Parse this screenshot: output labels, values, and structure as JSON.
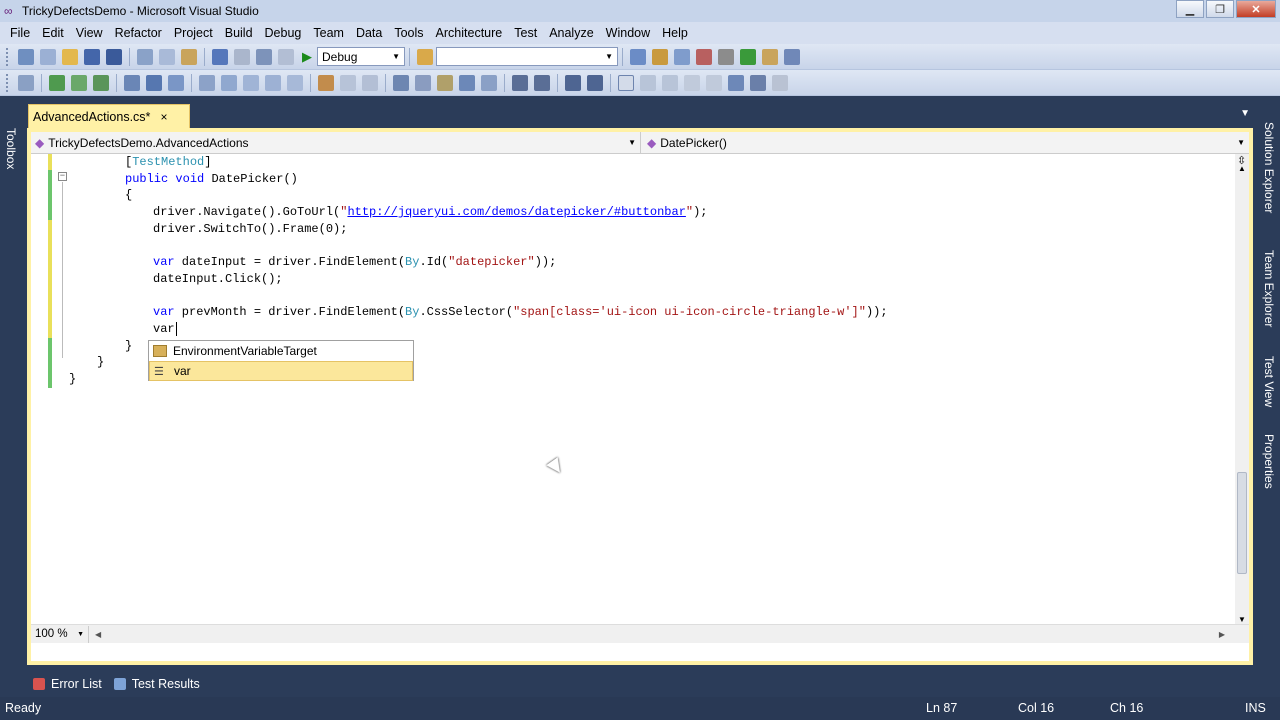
{
  "window": {
    "title": "TrickyDefectsDemo - Microsoft Visual Studio"
  },
  "menu": [
    "File",
    "Edit",
    "View",
    "Refactor",
    "Project",
    "Build",
    "Debug",
    "Team",
    "Data",
    "Tools",
    "Architecture",
    "Test",
    "Analyze",
    "Window",
    "Help"
  ],
  "toolbar": {
    "config_value": "Debug",
    "platform_value": ""
  },
  "sidebars": {
    "left": "Toolbox",
    "right": [
      "Solution Explorer",
      "Team Explorer",
      "Test View",
      "Properties"
    ]
  },
  "doc_tab": {
    "label": "AdvancedActions.cs*",
    "close": "×"
  },
  "nav": {
    "type_selector": "TrickyDefectsDemo.AdvancedActions",
    "member_selector": "DatePicker()"
  },
  "code": {
    "l1_attr": "TestMethod",
    "l2_kw1": "public",
    "l2_kw2": "void",
    "l2_name": "DatePicker()",
    "l3": "{",
    "l4_a": "driver.Navigate().GoToUrl(",
    "l4_str_q1": "\"",
    "l4_link": "http://jqueryui.com/demos/datepicker/#buttonbar",
    "l4_str_q2": "\"",
    "l4_b": ");",
    "l5": "driver.SwitchTo().Frame(0);",
    "l6_kw": "var",
    "l6_a": " dateInput = driver.FindElement(",
    "l6_ty": "By",
    "l6_b": ".Id(",
    "l6_str": "\"datepicker\"",
    "l6_c": "));",
    "l7": "dateInput.Click();",
    "l8_kw": "var",
    "l8_a": " prevMonth = driver.FindElement(",
    "l8_ty": "By",
    "l8_b": ".CssSelector(",
    "l8_str": "\"span[class='ui-icon ui-icon-circle-triangle-w']\"",
    "l8_c": "));",
    "l9_kw": "var",
    "l10": "}",
    "l11": "}",
    "l12": "}"
  },
  "intellisense": {
    "items": [
      "EnvironmentVariableTarget",
      "var"
    ],
    "selected": "var"
  },
  "zoom": "100 %",
  "bottom_tabs": [
    "Error List",
    "Test Results"
  ],
  "status": {
    "text": "Ready",
    "ln": "Ln 87",
    "col": "Col 16",
    "ch": "Ch 16",
    "mode": "INS"
  }
}
